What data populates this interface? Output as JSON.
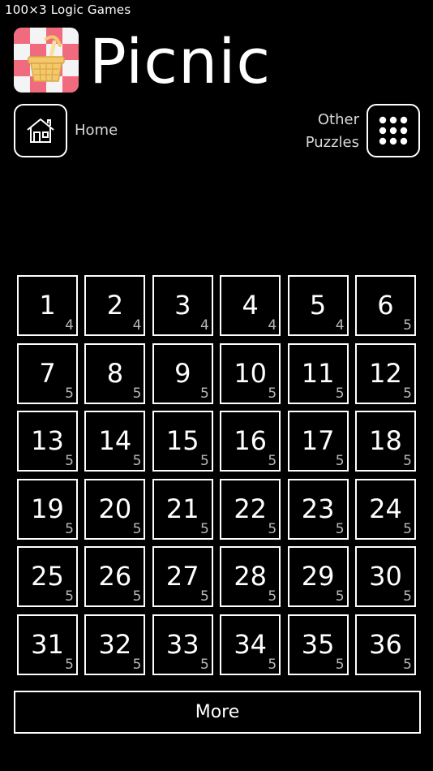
{
  "header": {
    "brand": "100×3 Logic Games",
    "title": "Picnic"
  },
  "nav": {
    "home_label": "Home",
    "other_label_line1": "Other",
    "other_label_line2": "Puzzles"
  },
  "icons": {
    "app": "picnic-basket-icon",
    "home": "house-icon",
    "other": "grid-dots-icon"
  },
  "colors": {
    "background": "#000000",
    "foreground": "#ffffff",
    "checker_pink": "#f06b7d",
    "checker_white": "#f4f4f4",
    "basket": "#f3c96a"
  },
  "levels": [
    {
      "num": "1",
      "size": "4"
    },
    {
      "num": "2",
      "size": "4"
    },
    {
      "num": "3",
      "size": "4"
    },
    {
      "num": "4",
      "size": "4"
    },
    {
      "num": "5",
      "size": "4"
    },
    {
      "num": "6",
      "size": "5"
    },
    {
      "num": "7",
      "size": "5"
    },
    {
      "num": "8",
      "size": "5"
    },
    {
      "num": "9",
      "size": "5"
    },
    {
      "num": "10",
      "size": "5"
    },
    {
      "num": "11",
      "size": "5"
    },
    {
      "num": "12",
      "size": "5"
    },
    {
      "num": "13",
      "size": "5"
    },
    {
      "num": "14",
      "size": "5"
    },
    {
      "num": "15",
      "size": "5"
    },
    {
      "num": "16",
      "size": "5"
    },
    {
      "num": "17",
      "size": "5"
    },
    {
      "num": "18",
      "size": "5"
    },
    {
      "num": "19",
      "size": "5"
    },
    {
      "num": "20",
      "size": "5"
    },
    {
      "num": "21",
      "size": "5"
    },
    {
      "num": "22",
      "size": "5"
    },
    {
      "num": "23",
      "size": "5"
    },
    {
      "num": "24",
      "size": "5"
    },
    {
      "num": "25",
      "size": "5"
    },
    {
      "num": "26",
      "size": "5"
    },
    {
      "num": "27",
      "size": "5"
    },
    {
      "num": "28",
      "size": "5"
    },
    {
      "num": "29",
      "size": "5"
    },
    {
      "num": "30",
      "size": "5"
    },
    {
      "num": "31",
      "size": "5"
    },
    {
      "num": "32",
      "size": "5"
    },
    {
      "num": "33",
      "size": "5"
    },
    {
      "num": "34",
      "size": "5"
    },
    {
      "num": "35",
      "size": "5"
    },
    {
      "num": "36",
      "size": "5"
    }
  ],
  "footer": {
    "more_label": "More"
  }
}
